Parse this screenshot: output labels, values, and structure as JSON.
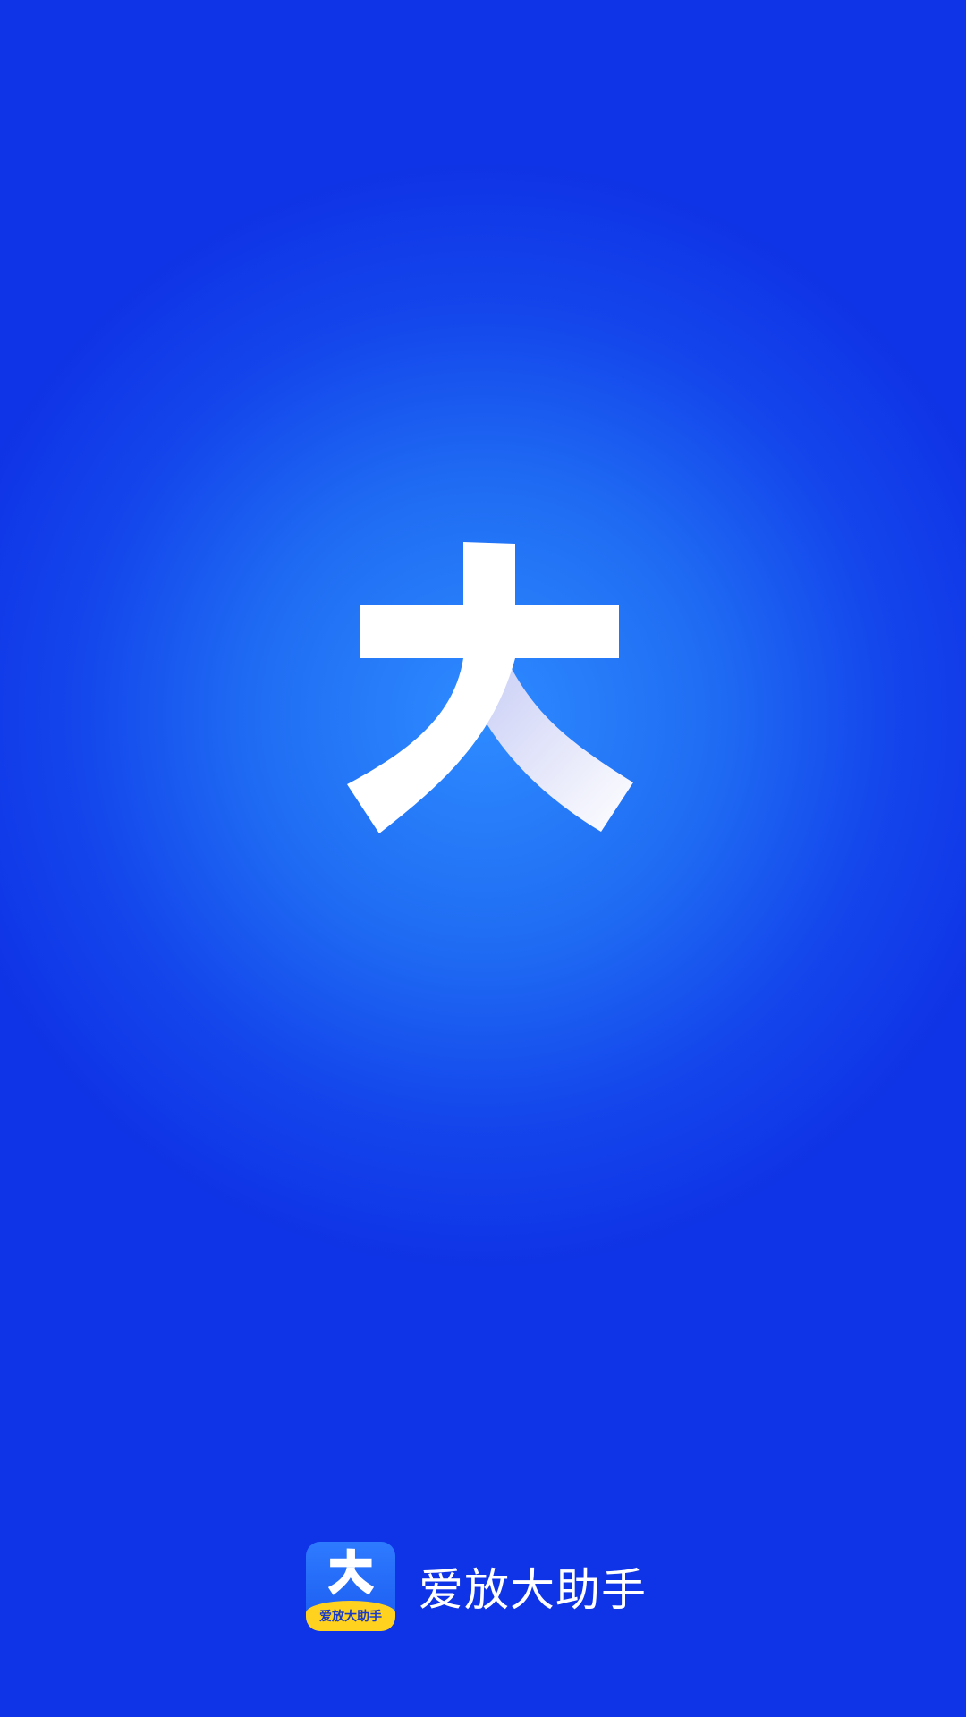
{
  "splash": {
    "app_name": "爱放大助手",
    "icon": {
      "name": "app-logo-icon",
      "banner_text": "爱放大助手"
    },
    "hero": {
      "name": "da-character-logo"
    },
    "colors": {
      "background_center": "#2E8BFF",
      "background_edge": "#0F33E6",
      "logo": "#FFFFFF",
      "icon_banner": "#FFD21F"
    }
  }
}
